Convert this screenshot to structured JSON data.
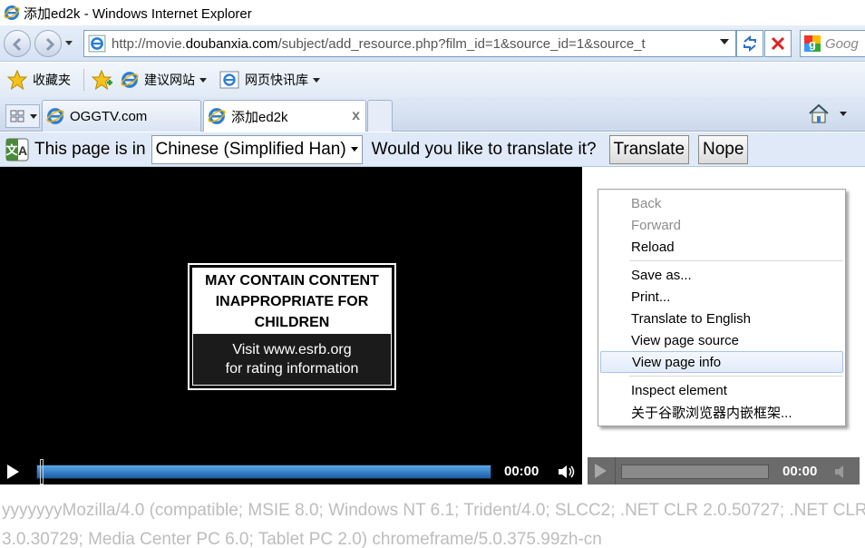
{
  "window": {
    "title": "添加ed2k - Windows Internet Explorer"
  },
  "address_bar": {
    "url_prefix": "http://movie.",
    "url_domain": "doubanxia.com",
    "url_suffix": "/subject/add_resource.php?film_id=1&source_id=1&source_t",
    "search_placeholder": "Goog"
  },
  "favorites_bar": {
    "favorites_label": "收藏夹",
    "items": [
      {
        "label": "建议网站"
      },
      {
        "label": "网页快讯库"
      }
    ]
  },
  "tabs": [
    {
      "label": "OGGTV.com",
      "active": false
    },
    {
      "label": "添加ed2k",
      "active": true,
      "close": "x"
    }
  ],
  "translate_bar": {
    "message": "This page is in",
    "language": "Chinese (Simplified Han)",
    "question": "Would you like to translate it?",
    "translate_label": "Translate",
    "nope_label": "Nope"
  },
  "video": {
    "rating_line1": "MAY CONTAIN CONTENT",
    "rating_line2": "INAPPROPRIATE FOR CHILDREN",
    "rating_line3": "Visit www.esrb.org",
    "rating_line4": "for rating information",
    "time": "00:00",
    "progress": 0
  },
  "video2": {
    "time": "00:00"
  },
  "context_menu": {
    "items": [
      {
        "label": "Back",
        "disabled": true
      },
      {
        "label": "Forward",
        "disabled": true
      },
      {
        "label": "Reload",
        "disabled": false
      },
      {
        "label": "Save as...",
        "disabled": false
      },
      {
        "label": "Print...",
        "disabled": false
      },
      {
        "label": "Translate to English",
        "disabled": false
      },
      {
        "label": "View page source",
        "disabled": false
      },
      {
        "label": "View page info",
        "disabled": false,
        "highlighted": true
      },
      {
        "label": "Inspect element",
        "disabled": false
      },
      {
        "label": "关于谷歌浏览器内嵌框架...",
        "disabled": false
      }
    ]
  },
  "footer": {
    "line1": "yyyyyyyMozilla/4.0 (compatible; MSIE 8.0; Windows NT 6.1; Trident/4.0; SLCC2; .NET CLR 2.0.50727; .NET CLR",
    "line2": "3.0.30729; Media Center PC 6.0; Tablet PC 2.0) chromeframe/5.0.375.99zh-cn"
  },
  "colors": {
    "seek_bar": "#2f7fcf",
    "menu_highlight": "#e2ecfa"
  }
}
